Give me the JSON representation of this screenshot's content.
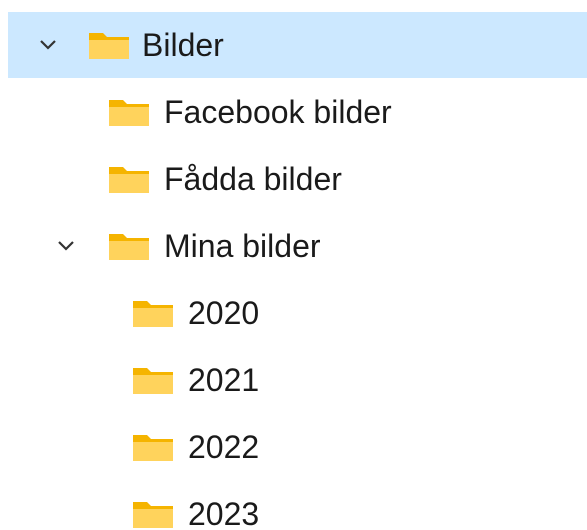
{
  "tree": {
    "items": [
      {
        "label": "Bilder",
        "level": 0,
        "expanded": true,
        "selected": true,
        "has_children": true
      },
      {
        "label": "Facebook bilder",
        "level": 1,
        "expanded": false,
        "selected": false,
        "has_children": false
      },
      {
        "label": "Fådda bilder",
        "level": 1,
        "expanded": false,
        "selected": false,
        "has_children": false
      },
      {
        "label": "Mina bilder",
        "level": 1,
        "expanded": true,
        "selected": false,
        "has_children": true
      },
      {
        "label": "2020",
        "level": 2,
        "expanded": false,
        "selected": false,
        "has_children": false
      },
      {
        "label": "2021",
        "level": 2,
        "expanded": false,
        "selected": false,
        "has_children": false
      },
      {
        "label": "2022",
        "level": 2,
        "expanded": false,
        "selected": false,
        "has_children": false
      },
      {
        "label": "2023",
        "level": 2,
        "expanded": false,
        "selected": false,
        "has_children": false
      }
    ]
  },
  "colors": {
    "selection": "#cce8ff",
    "folder_front": "#ffd35c",
    "folder_back": "#f5b400",
    "chevron": "#333333"
  },
  "icons": {
    "chevron": "chevron-down-icon",
    "folder": "folder-icon"
  }
}
